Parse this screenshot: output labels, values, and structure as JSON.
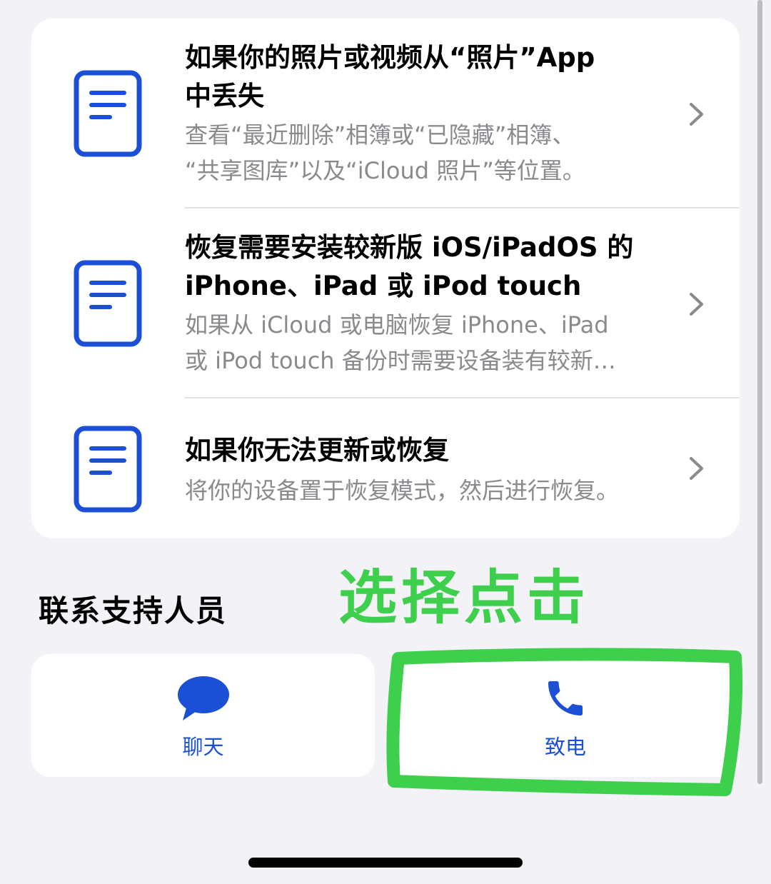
{
  "articles": [
    {
      "icon": "document-icon",
      "title": "如果你的照片或视频从“照片”App\n中丢失",
      "subtitle": "查看“最近删除”相簿或“已隐藏”相簿、\n“共享图库”以及“iCloud 照片”等位置。"
    },
    {
      "icon": "document-icon",
      "title": "恢复需要安装较新版 iOS/iPadOS 的\niPhone、iPad 或 iPod touch",
      "subtitle": "如果从 iCloud 或电脑恢复 iPhone、iPad\n或 iPod touch 备份时需要设备装有较新…"
    },
    {
      "icon": "document-icon",
      "title": "如果你无法更新或恢复",
      "subtitle": "将你的设备置于恢复模式，然后进行恢复。"
    }
  ],
  "contact": {
    "section_title": "联系支持人员",
    "chat_label": "聊天",
    "call_label": "致电",
    "chat_icon": "speech-bubble-icon",
    "call_icon": "phone-icon"
  },
  "annotation": {
    "text": "选择点击",
    "color": "#3ecf4c"
  },
  "colors": {
    "accent": "#1a4fd6",
    "background": "#f2f2f7",
    "secondary_text": "#8a8a8e"
  }
}
